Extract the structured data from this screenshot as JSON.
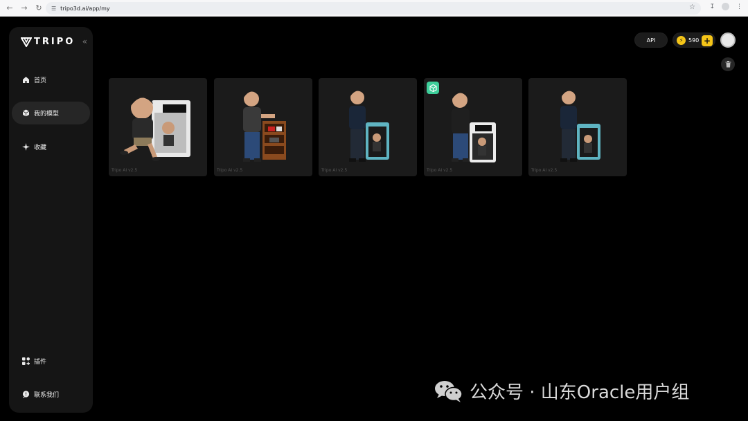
{
  "browser": {
    "url": "tripo3d.ai/app/my"
  },
  "brand": {
    "name": "TRIPO",
    "collapse_glyph": "«"
  },
  "nav": {
    "home": "首页",
    "my_models": "我的模型",
    "favorites": "收藏",
    "plugins": "插件",
    "contact": "联系我们"
  },
  "topbar": {
    "api_label": "API",
    "credits": "590",
    "add_label": "+"
  },
  "models": [
    {
      "caption": "Tripo AI v2.5",
      "has_badge": false
    },
    {
      "caption": "Tripo AI v2.5",
      "has_badge": false
    },
    {
      "caption": "Tripo AI v2.5",
      "has_badge": false
    },
    {
      "caption": "Tripo AI v2.5",
      "has_badge": true
    },
    {
      "caption": "Tripo AI v2.5",
      "has_badge": false
    }
  ],
  "watermark": {
    "text": "公众号 · 山东Oracle用户组"
  },
  "colors": {
    "accent_gold": "#f5c518",
    "badge_green": "#3ecf9b",
    "sidebar_bg": "#151515",
    "card_bg": "#1b1b1b"
  }
}
